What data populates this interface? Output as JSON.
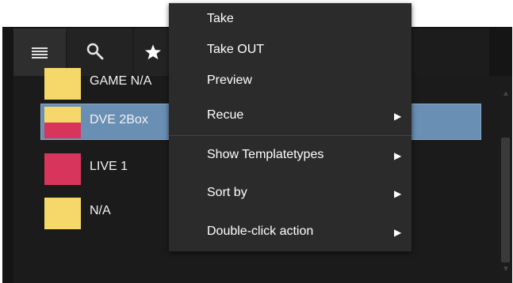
{
  "toolbar": {
    "buttons": [
      {
        "name": "list-icon"
      },
      {
        "name": "search-icon"
      },
      {
        "name": "star-icon"
      }
    ]
  },
  "list": {
    "items": [
      {
        "label": "GAME N/A",
        "swatch": [
          "#f6d86a"
        ]
      },
      {
        "label": "DVE 2Box",
        "swatch": [
          "#f6d86a",
          "#d7355b"
        ],
        "selected": true
      },
      {
        "label": "LIVE 1",
        "swatch": [
          "#d7355b"
        ]
      },
      {
        "label": "N/A",
        "swatch": [
          "#f6d86a"
        ]
      }
    ]
  },
  "context_menu": {
    "items": [
      {
        "label": "Take",
        "submenu": false
      },
      {
        "label": "Take OUT",
        "submenu": false
      },
      {
        "label": "Preview",
        "submenu": false
      },
      {
        "label": "Recue",
        "submenu": true
      },
      {
        "label": "Show Templatetypes",
        "submenu": true
      },
      {
        "label": "Sort by",
        "submenu": true
      },
      {
        "label": "Double-click action",
        "submenu": true
      }
    ]
  },
  "colors": {
    "selection": "#6a8fb4",
    "menu_bg": "#2b2b2b",
    "panel_bg": "#151515"
  }
}
